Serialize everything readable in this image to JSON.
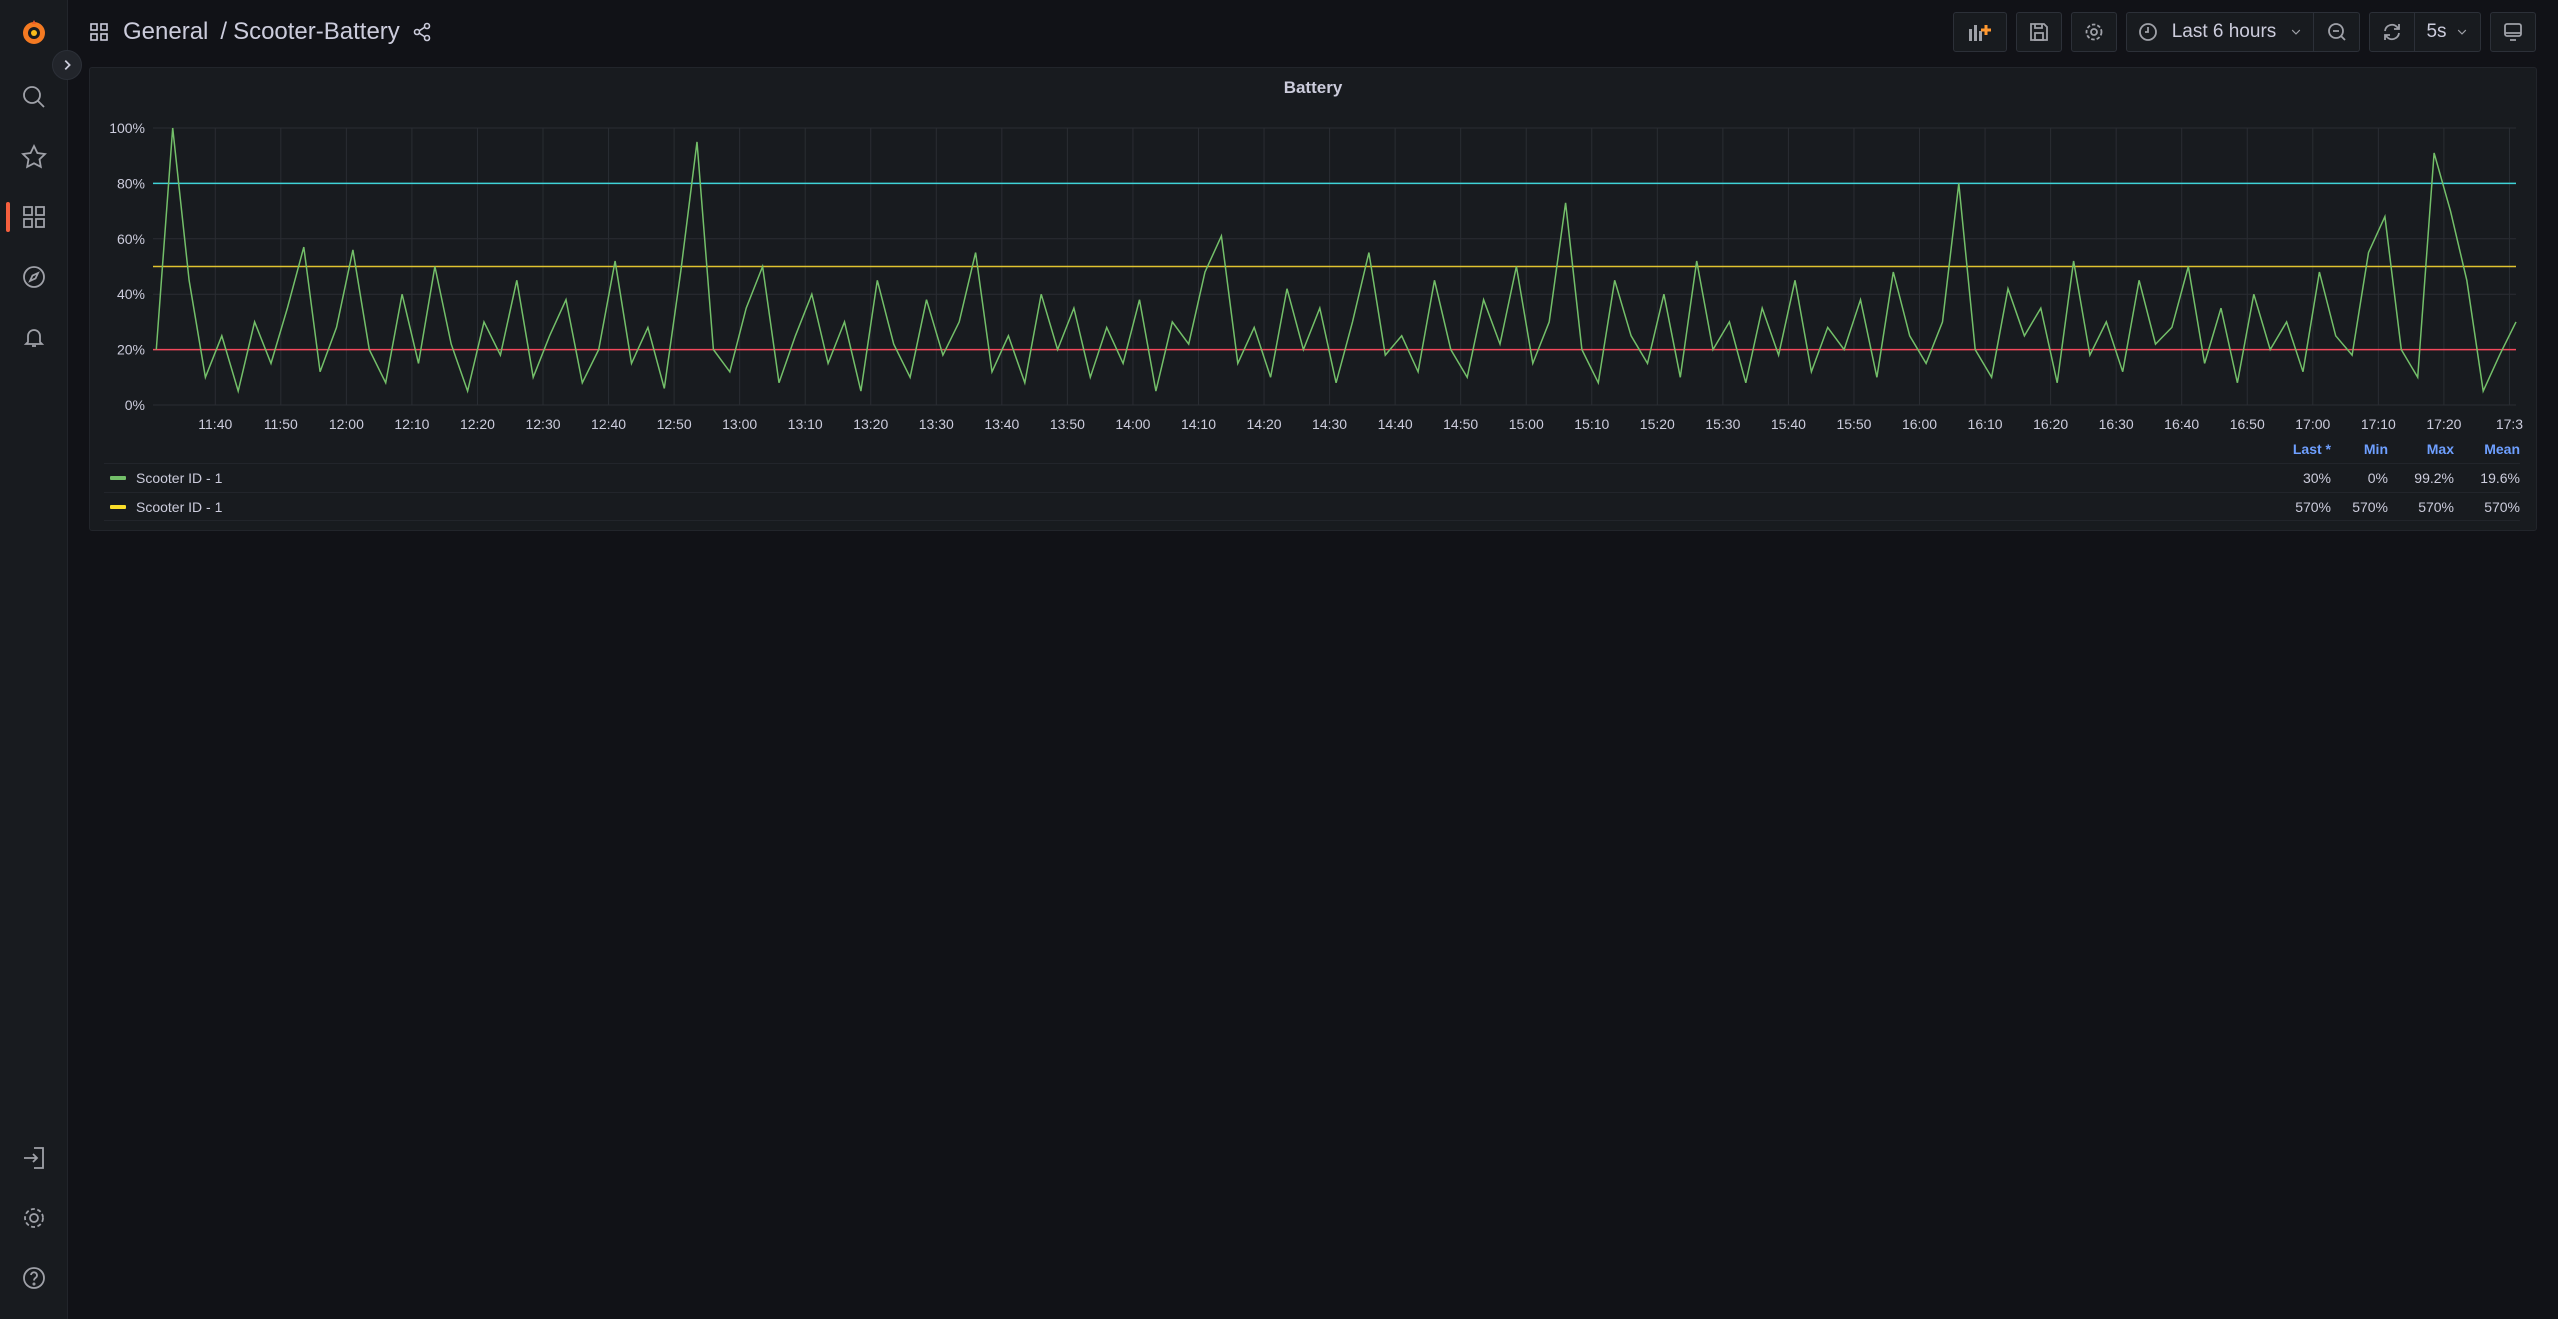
{
  "header": {
    "breadcrumb_folder": "General",
    "breadcrumb_sep": "/",
    "dashboard_title": "Scooter-Battery"
  },
  "toolbar": {
    "time_range": "Last 6 hours",
    "refresh_interval": "5s"
  },
  "sidebar": {
    "icons": [
      "grafana-logo",
      "search-icon",
      "star-icon",
      "dashboards-icon",
      "explore-icon",
      "alert-bell-icon",
      "sign-in-icon",
      "gear-icon",
      "help-icon"
    ],
    "active": "dashboards-icon"
  },
  "colors": {
    "accent": "#f55f3e",
    "series_green": "#73bf69",
    "series_yellow": "#fade2a",
    "threshold_cyan": "#3fd3d8",
    "threshold_yellow": "#e0c330",
    "threshold_red": "#f2495c",
    "header_blue": "#6e9fff"
  },
  "panel": {
    "title": "Battery"
  },
  "chart_data": {
    "type": "line",
    "title": "Battery",
    "x_start": "11:31",
    "x_end": "17:31",
    "x_step_minutes": 2.5,
    "x_ticks": [
      "11:40",
      "11:50",
      "12:00",
      "12:10",
      "12:20",
      "12:30",
      "12:40",
      "12:50",
      "13:00",
      "13:10",
      "13:20",
      "13:30",
      "13:40",
      "13:50",
      "14:00",
      "14:10",
      "14:20",
      "14:30",
      "14:40",
      "14:50",
      "15:00",
      "15:10",
      "15:20",
      "15:30",
      "15:40",
      "15:50",
      "16:00",
      "16:10",
      "16:20",
      "16:30",
      "16:40",
      "16:50",
      "17:00",
      "17:10",
      "17:20",
      "17:3"
    ],
    "y_ticks": [
      "0%",
      "20%",
      "40%",
      "60%",
      "80%",
      "100%"
    ],
    "ylim": [
      0,
      100
    ],
    "grid": true,
    "legend_placement": "bottom",
    "thresholds": [
      {
        "value": 80,
        "color": "#3fd3d8"
      },
      {
        "value": 50,
        "color": "#e0c330"
      },
      {
        "value": 20,
        "color": "#f2495c"
      }
    ],
    "series": [
      {
        "name": "Scooter ID - 1",
        "color": "#73bf69",
        "values": [
          20,
          100,
          45,
          10,
          25,
          5,
          30,
          15,
          35,
          57,
          12,
          28,
          56,
          20,
          8,
          40,
          15,
          50,
          22,
          5,
          30,
          18,
          45,
          10,
          25,
          38,
          8,
          20,
          52,
          15,
          28,
          6,
          48,
          95,
          20,
          12,
          35,
          50,
          8,
          25,
          40,
          15,
          30,
          5,
          45,
          22,
          10,
          38,
          18,
          30,
          55,
          12,
          25,
          8,
          40,
          20,
          35,
          10,
          28,
          15,
          38,
          5,
          30,
          22,
          48,
          61,
          15,
          28,
          10,
          42,
          20,
          35,
          8,
          30,
          55,
          18,
          25,
          12,
          45,
          20,
          10,
          38,
          22,
          50,
          15,
          30,
          73,
          20,
          8,
          45,
          25,
          15,
          40,
          10,
          52,
          20,
          30,
          8,
          35,
          18,
          45,
          12,
          28,
          20,
          38,
          10,
          48,
          25,
          15,
          30,
          80,
          20,
          10,
          42,
          25,
          35,
          8,
          52,
          18,
          30,
          12,
          45,
          22,
          28,
          50,
          15,
          35,
          8,
          40,
          20,
          30,
          12,
          48,
          25,
          18,
          55,
          68,
          20,
          10,
          91,
          70,
          45,
          5,
          18,
          30
        ]
      },
      {
        "name": "Scooter ID - 1",
        "color": "#fade2a",
        "values": [
          570
        ]
      }
    ]
  },
  "legend": {
    "headers": [
      "Last *",
      "Min",
      "Max",
      "Mean"
    ],
    "rows": [
      {
        "name": "Scooter ID - 1",
        "color": "#73bf69",
        "last": "30%",
        "min": "0%",
        "max": "99.2%",
        "mean": "19.6%"
      },
      {
        "name": "Scooter ID - 1",
        "color": "#fade2a",
        "last": "570%",
        "min": "570%",
        "max": "570%",
        "mean": "570%"
      }
    ]
  }
}
